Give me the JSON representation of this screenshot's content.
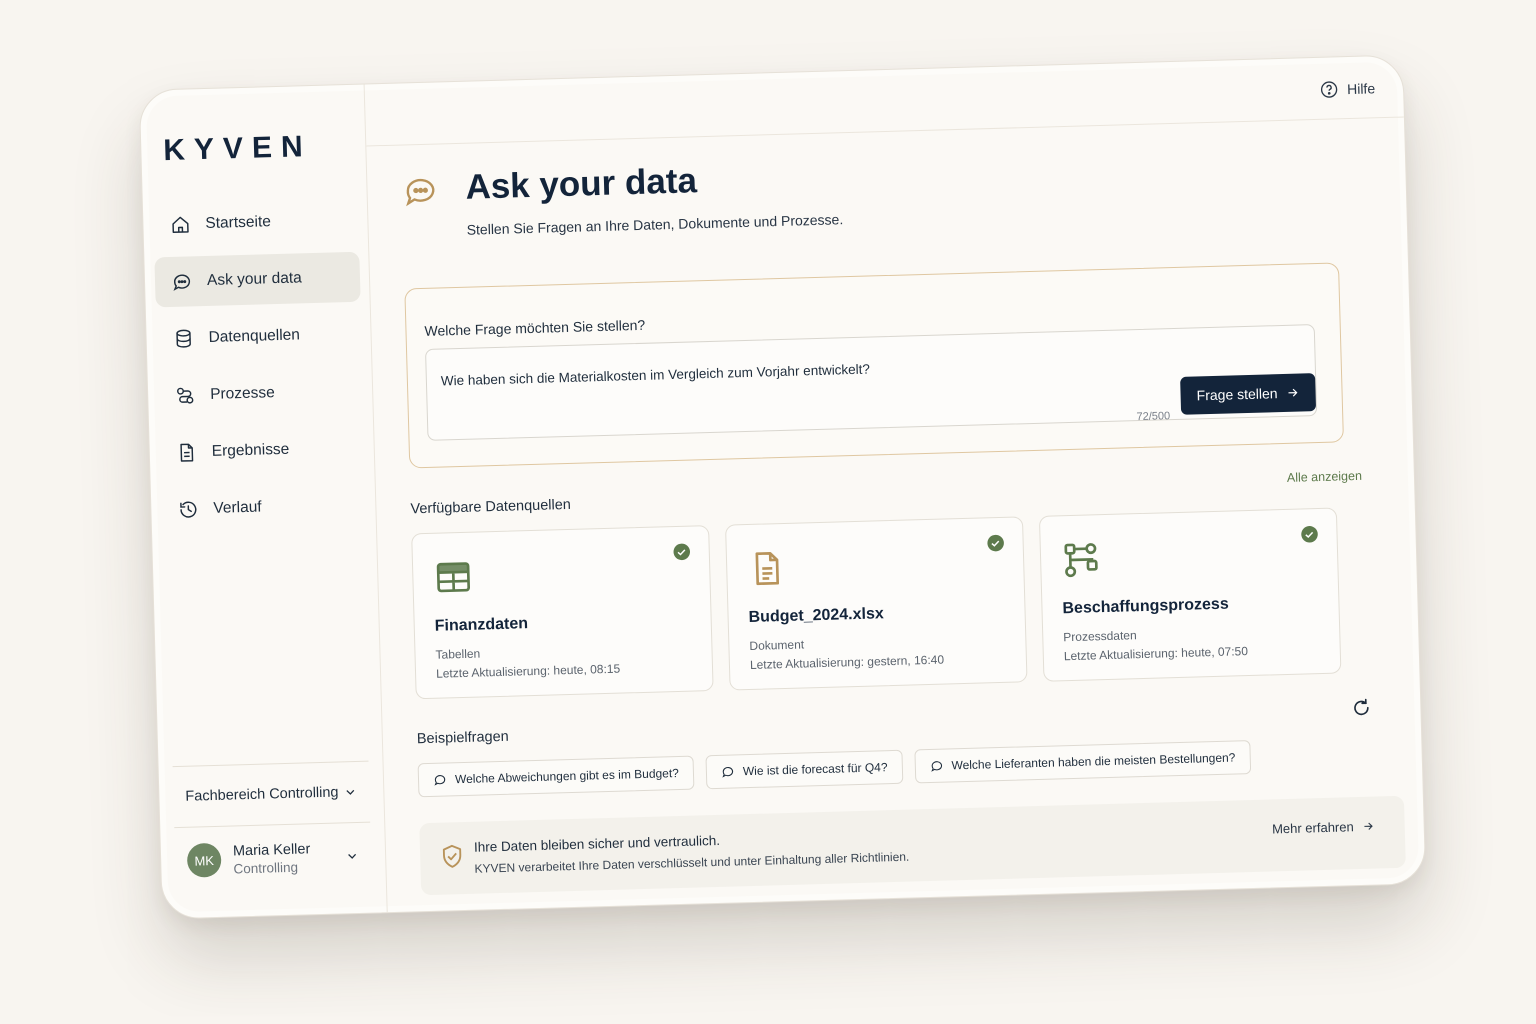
{
  "brand": {
    "logo": "KYVEN"
  },
  "sidebar": {
    "items": [
      {
        "label": "Startseite",
        "icon": "home-icon"
      },
      {
        "label": "Ask your data",
        "icon": "chat-icon",
        "active": true
      },
      {
        "label": "Datenquellen",
        "icon": "database-icon"
      },
      {
        "label": "Prozesse",
        "icon": "process-icon"
      },
      {
        "label": "Ergebnisse",
        "icon": "document-icon"
      },
      {
        "label": "Verlauf",
        "icon": "history-icon"
      }
    ],
    "department": "Fachbereich Controlling",
    "user": {
      "initials": "MK",
      "name": "Maria Keller",
      "role": "Controlling"
    }
  },
  "header": {
    "help_label": "Hilfe"
  },
  "page": {
    "title": "Ask your data",
    "subtitle": "Stellen Sie Fragen an Ihre Daten, Dokumente und Prozesse."
  },
  "ask": {
    "label": "Welche Frage möchten Sie stellen?",
    "value": "Wie haben sich die Materialkosten im Vergleich zum Vorjahr entwickelt?",
    "counter": "72/500",
    "button_label": "Frage stellen"
  },
  "sources": {
    "title": "Verfügbare Datenquellen",
    "show_all": "Alle anzeigen",
    "cards": [
      {
        "title": "Finanzdaten",
        "type": "Tabellen",
        "updated": "Letzte Aktualisierung: heute, 08:15",
        "icon": "table-icon"
      },
      {
        "title": "Budget_2024.xlsx",
        "type": "Dokument",
        "updated": "Letzte Aktualisierung: gestern, 16:40",
        "icon": "file-icon"
      },
      {
        "title": "Beschaffungsprozess",
        "type": "Prozessdaten",
        "updated": "Letzte Aktualisierung: heute, 07:50",
        "icon": "flow-icon"
      }
    ]
  },
  "examples": {
    "title": "Beispielfragen",
    "chips": [
      "Welche Abweichungen gibt es im Budget?",
      "Wie ist die forecast für Q4?",
      "Welche Lieferanten haben die meisten Bestellungen?"
    ]
  },
  "privacy": {
    "line1": "Ihre Daten bleiben sicher und vertraulich.",
    "line2": "KYVEN verarbeitet Ihre Daten verschlüsselt und unter Einhaltung aller Richtlinien.",
    "more": "Mehr erfahren"
  },
  "colors": {
    "navy": "#13243a",
    "accent_gold": "#b8935a",
    "accent_green": "#5d7a4c",
    "background": "#f8f5f0"
  }
}
